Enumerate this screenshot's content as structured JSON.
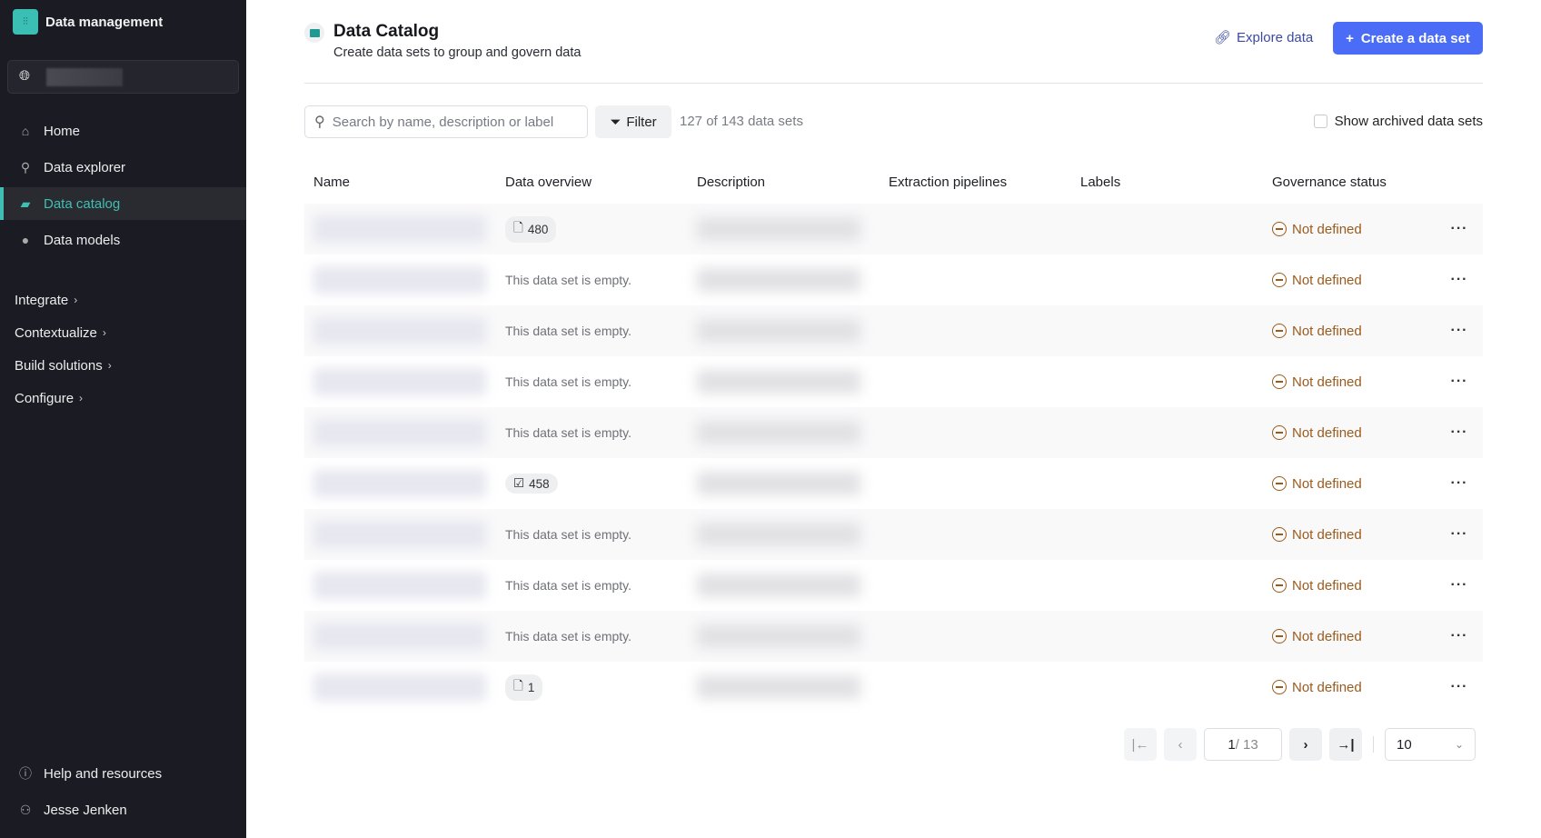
{
  "app": {
    "title": "Data management",
    "icons": {
      "logo": "cognite-logo",
      "project": "globe-icon"
    }
  },
  "sidebar": {
    "items": [
      {
        "label": "Home",
        "icon": "home-icon",
        "glyph": "⌂"
      },
      {
        "label": "Data explorer",
        "icon": "search-icon",
        "glyph": "⚲"
      },
      {
        "label": "Data catalog",
        "icon": "folder-icon",
        "glyph": "▰",
        "active": true
      },
      {
        "label": "Data models",
        "icon": "models-icon",
        "glyph": "●"
      }
    ],
    "groups": [
      {
        "label": "Integrate"
      },
      {
        "label": "Contextualize"
      },
      {
        "label": "Build solutions"
      },
      {
        "label": "Configure"
      }
    ],
    "help": "Help and resources",
    "user": "Jesse Jenken"
  },
  "header": {
    "title": "Data Catalog",
    "subtitle": "Create data sets to group and govern data",
    "explore": "Explore data",
    "create": "Create a data set",
    "create_icon": "+"
  },
  "toolbar": {
    "search_placeholder": "Search by name, description or label",
    "filter": "Filter",
    "count": "127 of 143 data sets",
    "archived": "Show archived data sets"
  },
  "table": {
    "columns": [
      "Name",
      "Data overview",
      "Description",
      "Extraction pipelines",
      "Labels",
      "Governance status"
    ],
    "rows": [
      {
        "overview": "480",
        "overview_icon": "file-icon",
        "status": "Not defined"
      },
      {
        "overview": "This data set is empty.",
        "status": "Not defined"
      },
      {
        "overview": "This data set is empty.",
        "status": "Not defined"
      },
      {
        "overview": "This data set is empty.",
        "status": "Not defined"
      },
      {
        "overview": "This data set is empty.",
        "status": "Not defined"
      },
      {
        "overview": "458",
        "overview_icon": "calendar-check-icon",
        "status": "Not defined"
      },
      {
        "overview": "This data set is empty.",
        "status": "Not defined"
      },
      {
        "overview": "This data set is empty.",
        "status": "Not defined"
      },
      {
        "overview": "This data set is empty.",
        "status": "Not defined"
      },
      {
        "overview": "1",
        "overview_icon": "file-icon",
        "status": "Not defined"
      }
    ]
  },
  "pagination": {
    "current": "1",
    "total": "/ 13",
    "page_size": "10"
  },
  "colors": {
    "accent": "#4a6cf7",
    "teal": "#3fbfb3",
    "status": "#9a5b1c",
    "sidebar": "#1b1c23"
  }
}
